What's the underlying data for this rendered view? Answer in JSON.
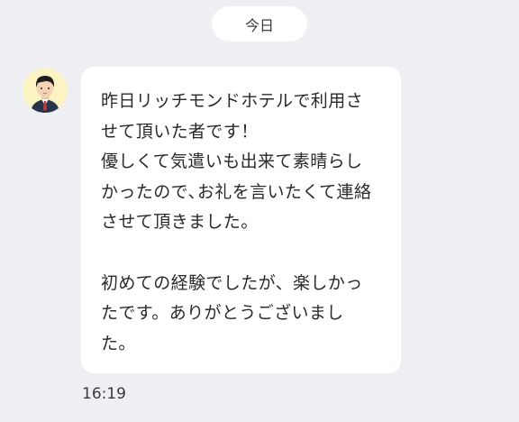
{
  "date_divider": {
    "label": "今日"
  },
  "message": {
    "avatar_icon": "person-in-suit-icon",
    "lines": [
      "昨日リッチモンドホテルで利用さ",
      "せて頂いた者です！",
      "優しくて気遣いも出来て素晴らし",
      "かったので､お礼を言いたくて連絡",
      "させて頂きました。",
      "",
      "初めての経験でしたが、楽しかっ",
      "たです。ありがとうございまし",
      "た。"
    ],
    "time": "16:19"
  },
  "colors": {
    "background": "#EDEFF2",
    "bubble": "#FFFFFF",
    "avatar_bg": "#FBF3C4"
  }
}
